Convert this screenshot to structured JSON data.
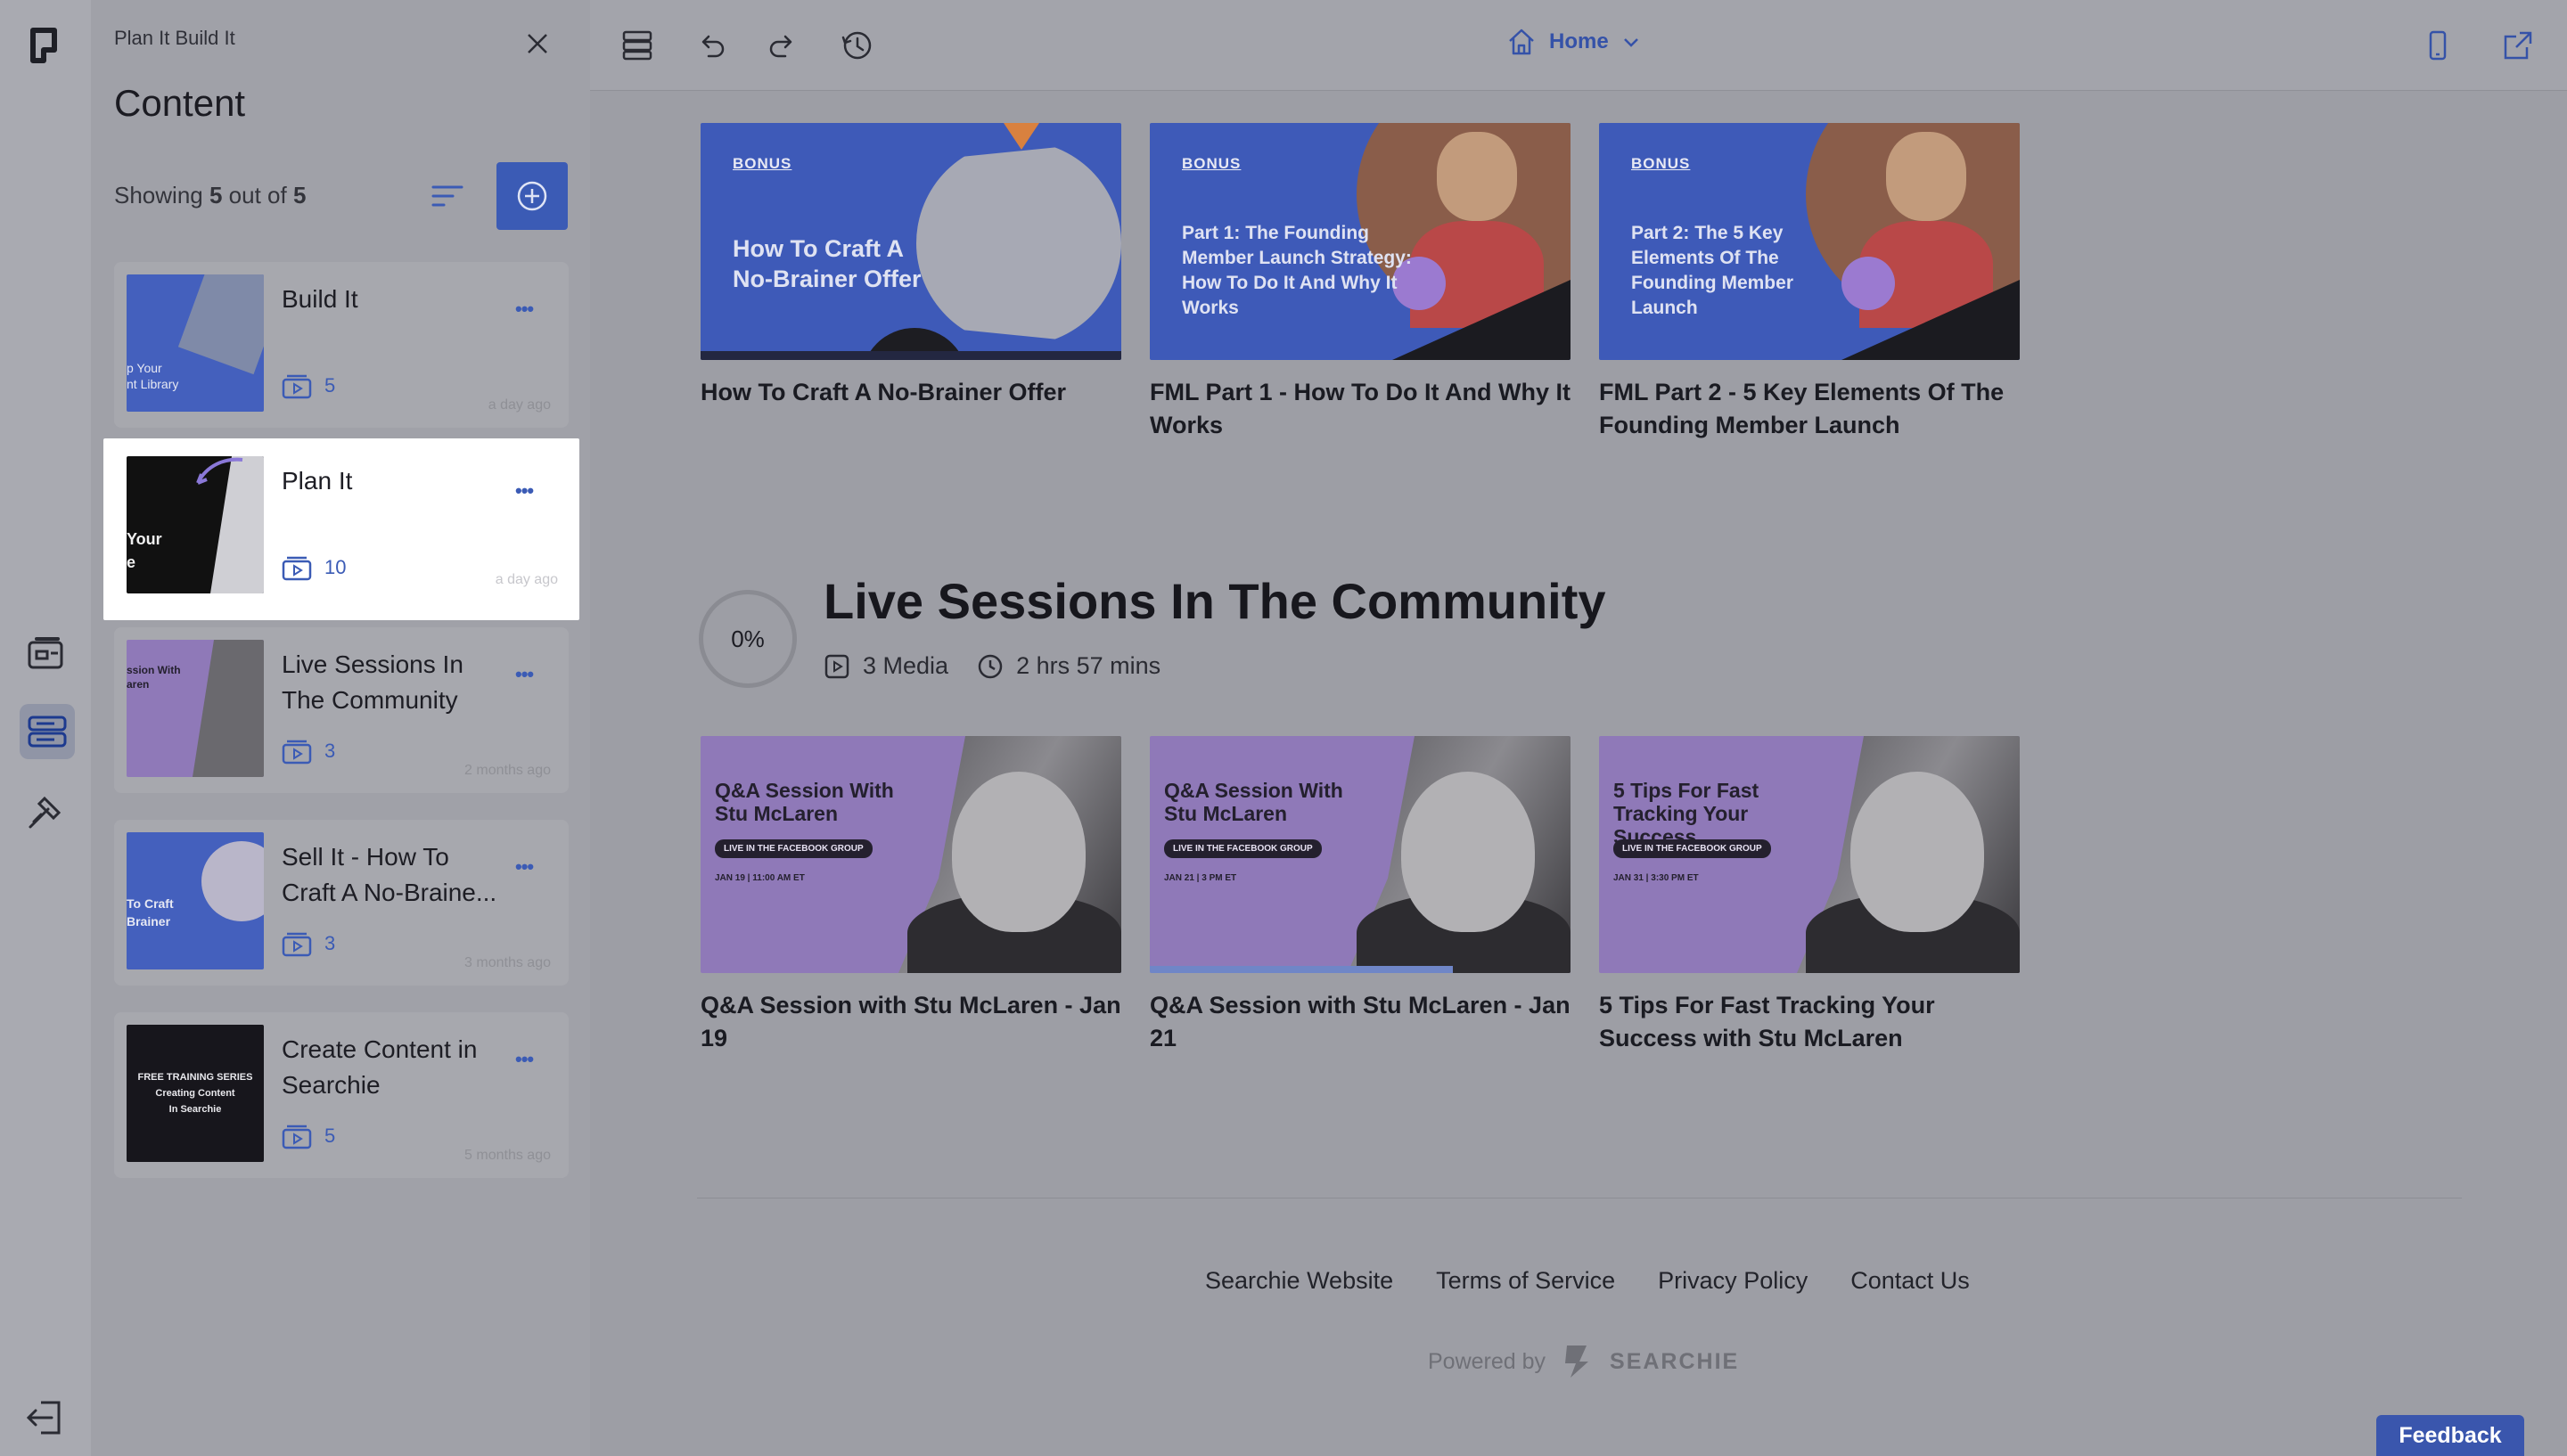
{
  "panel": {
    "breadcrumb": "Plan It Build It",
    "title": "Content",
    "showing_prefix": "Showing ",
    "showing_count": "5",
    "showing_mid": " out of ",
    "showing_total": "5",
    "items": [
      {
        "name": "Build It",
        "media_count": "5",
        "ago": "a day ago",
        "thumb_text": "p Your\nnt Library"
      },
      {
        "name": "Plan It",
        "media_count": "10",
        "ago": "a day ago",
        "thumb_text": "Your\ne"
      },
      {
        "name": "Live Sessions In The Community",
        "media_count": "3",
        "ago": "2 months ago",
        "thumb_text": "ssion With\naren"
      },
      {
        "name": "Sell It - How To Craft A No-Braine...",
        "media_count": "3",
        "ago": "3 months ago",
        "thumb_text": "To Craft\nBrainer"
      },
      {
        "name": "Create Content in Searchie",
        "media_count": "5",
        "ago": "5 months ago",
        "thumb_text": "FREE TRAINING SERIES\nCreating Content\nIn Searchie"
      }
    ]
  },
  "topbar": {
    "home_label": "Home"
  },
  "bonus_row": [
    {
      "tag": "BONUS",
      "image_text": "How To Craft A No-Brainer Offer",
      "caption": "How To Craft A No-Brainer Offer"
    },
    {
      "tag": "BONUS",
      "image_text": "Part 1: The Founding Member Launch Strategy: How To Do It And Why It Works",
      "caption": "FML Part 1 - How To Do It And Why It Works"
    },
    {
      "tag": "BONUS",
      "image_text": "Part 2: The 5 Key Elements Of The Founding Member Launch",
      "caption": "FML Part 2 - 5 Key Elements Of The Founding Member Launch"
    }
  ],
  "section": {
    "progress": "0%",
    "title": "Live Sessions In The Community",
    "media": "3 Media",
    "duration": "2 hrs 57 mins"
  },
  "session_row": [
    {
      "image_title": "Q&A Session With Stu McLaren",
      "pill": "LIVE IN THE FACEBOOK GROUP",
      "date": "JAN 19 | 11:00 AM ET",
      "caption": "Q&A Session with Stu McLaren - Jan 19"
    },
    {
      "image_title": "Q&A Session With Stu McLaren",
      "pill": "LIVE IN THE FACEBOOK GROUP",
      "date": "JAN 21 | 3 PM ET",
      "caption": "Q&A Session with Stu McLaren - Jan 21"
    },
    {
      "image_title": "5 Tips For Fast Tracking Your Success",
      "pill": "LIVE IN THE FACEBOOK GROUP",
      "date": "JAN 31 | 3:30 PM ET",
      "caption": "5 Tips For Fast Tracking Your Success with Stu McLaren"
    }
  ],
  "footer": {
    "links": [
      "Searchie Website",
      "Terms of Service",
      "Privacy Policy",
      "Contact Us"
    ],
    "powered_by": "Powered by",
    "brand": "SEARCHIE"
  },
  "feedback_label": "Feedback",
  "colors": {
    "accent": "#3b5bb5",
    "bonus_bg": "#3e5ab8",
    "session_bg": "#8f79b8"
  }
}
